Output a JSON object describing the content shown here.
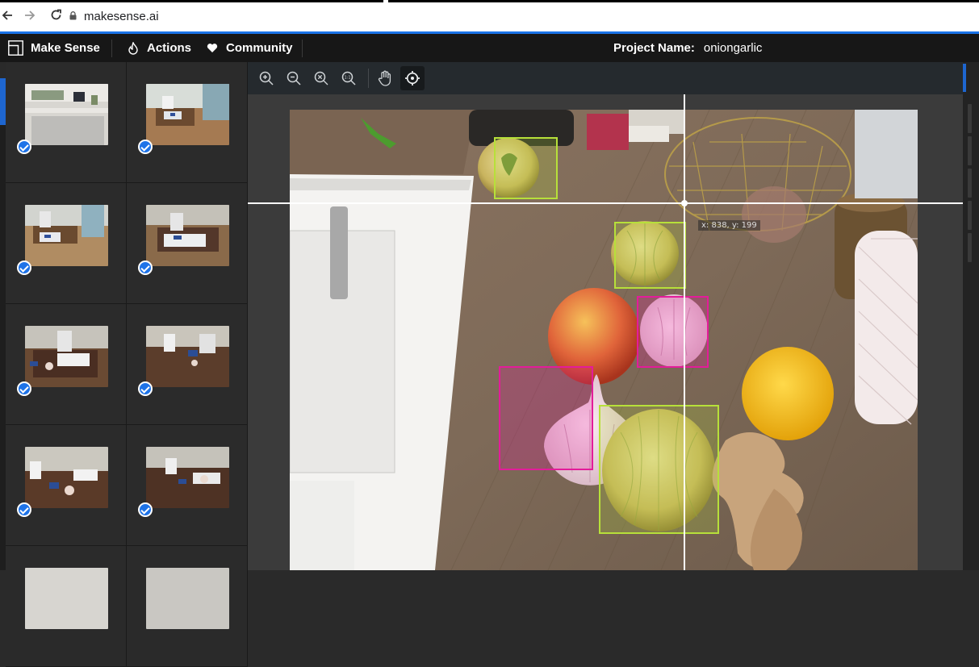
{
  "browser": {
    "url": "makesense.ai",
    "back_icon": "back-arrow-icon",
    "forward_icon": "forward-arrow-icon",
    "reload_icon": "reload-icon"
  },
  "nav": {
    "brand": "Make Sense",
    "actions": "Actions",
    "community": "Community",
    "project_label": "Project Name:",
    "project_value": "oniongarlic"
  },
  "toolbar": {
    "tools": [
      "zoom-in-icon",
      "zoom-out-icon",
      "zoom-fit-icon",
      "zoom-max-icon",
      "hand-icon",
      "crosshair-icon"
    ],
    "active": "crosshair-icon"
  },
  "thumbnails": [
    {
      "checked": true
    },
    {
      "checked": true
    },
    {
      "checked": true
    },
    {
      "checked": true
    },
    {
      "checked": true
    },
    {
      "checked": true
    },
    {
      "checked": true
    },
    {
      "checked": true
    },
    {
      "checked": false
    },
    {
      "checked": false
    }
  ],
  "editor": {
    "cursor_readout": "x: 838, y: 199",
    "labels": [
      {
        "class": "onion",
        "color": "#b7e03a"
      },
      {
        "class": "onion",
        "color": "#b7e03a"
      },
      {
        "class": "garlic",
        "color": "#e31c9a"
      },
      {
        "class": "garlic",
        "color": "#e31c9a"
      },
      {
        "class": "onion",
        "color": "#b7e03a"
      }
    ]
  },
  "colors": {
    "accent": "#1e73e8",
    "onion_box": "#b7e03a",
    "garlic_box": "#e31c9a"
  }
}
